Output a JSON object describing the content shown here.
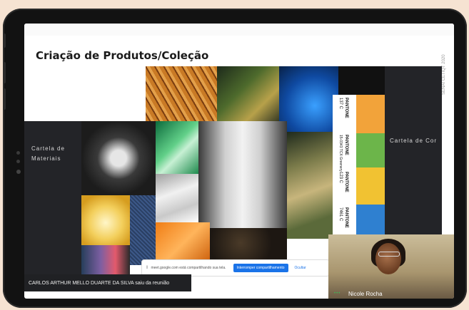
{
  "slide": {
    "title": "Criação de Produtos/Coleção",
    "side_label": "SENAI CETIQT 2020",
    "materials_card": [
      "Cartela de",
      "Materiais"
    ],
    "color_card": "Cartela de Cor",
    "pantone": [
      {
        "brand": "PANTONE",
        "code": "137 C",
        "color": "#f2a33a"
      },
      {
        "brand": "PANTONE",
        "code": "15-0343 TCX Greenery",
        "color": "#6cb54a"
      },
      {
        "brand": "PANTONE",
        "code": "123 C",
        "color": "#f1c232"
      },
      {
        "brand": "PANTONE",
        "code": "7461 C",
        "color": "#2f80d0"
      }
    ]
  },
  "share_bar": {
    "message": "meet.google.com está compartilhando sua tela.",
    "stop_button": "Interromper compartilhamento",
    "hide_link": "Ocultar"
  },
  "notification": {
    "text": "CARLOS ARTHUR MELLO DUARTE DA SILVA saiu da reunião"
  },
  "participant": {
    "name": "Nicole Rocha"
  }
}
